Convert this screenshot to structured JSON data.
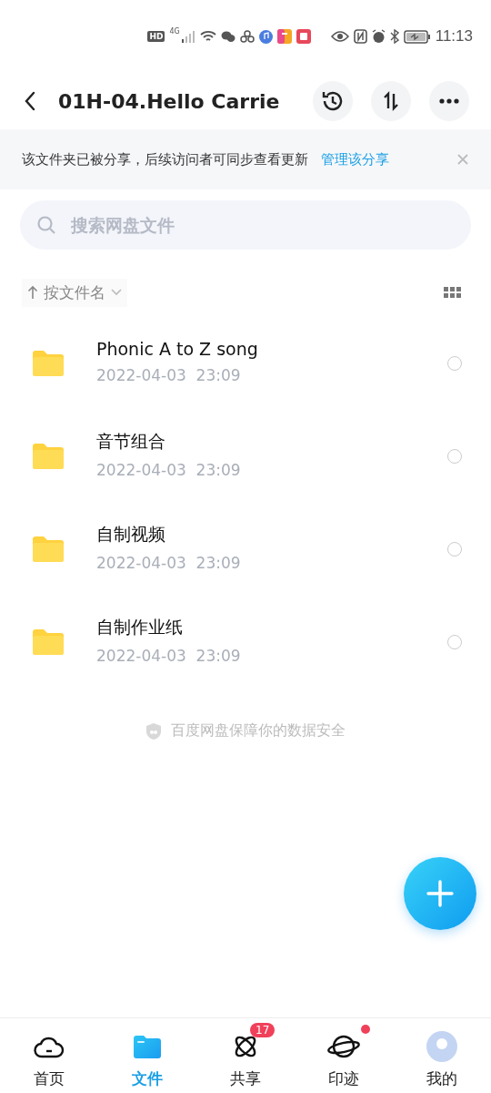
{
  "status_bar": {
    "network_badge": "HD",
    "network_type": "4G",
    "time": "11:13"
  },
  "header": {
    "title": "01H-04.Hello Carrie"
  },
  "share_banner": {
    "text": "该文件夹已被分享，后续访问者可同步查看更新",
    "link": "管理该分享"
  },
  "search": {
    "placeholder": "搜索网盘文件"
  },
  "sort": {
    "label": "按文件名"
  },
  "files": [
    {
      "name": "Phonic A to Z song",
      "date": "2022-04-03  23:09",
      "selected": false
    },
    {
      "name": "音节组合",
      "date": "2022-04-03  23:09",
      "selected": false
    },
    {
      "name": "自制视频",
      "date": "2022-04-03  23:09",
      "selected": false
    },
    {
      "name": "自制作业纸",
      "date": "2022-04-03  23:09",
      "selected": false
    }
  ],
  "security_note": "百度网盘保障你的数据安全",
  "tabs": [
    {
      "label": "首页",
      "kind": "cloud",
      "selected": false
    },
    {
      "label": "文件",
      "kind": "folder",
      "selected": true
    },
    {
      "label": "共享",
      "kind": "atom",
      "selected": false,
      "badge": "17"
    },
    {
      "label": "印迹",
      "kind": "planet",
      "selected": false,
      "dot": true
    },
    {
      "label": "我的",
      "kind": "avatar",
      "selected": false
    }
  ]
}
